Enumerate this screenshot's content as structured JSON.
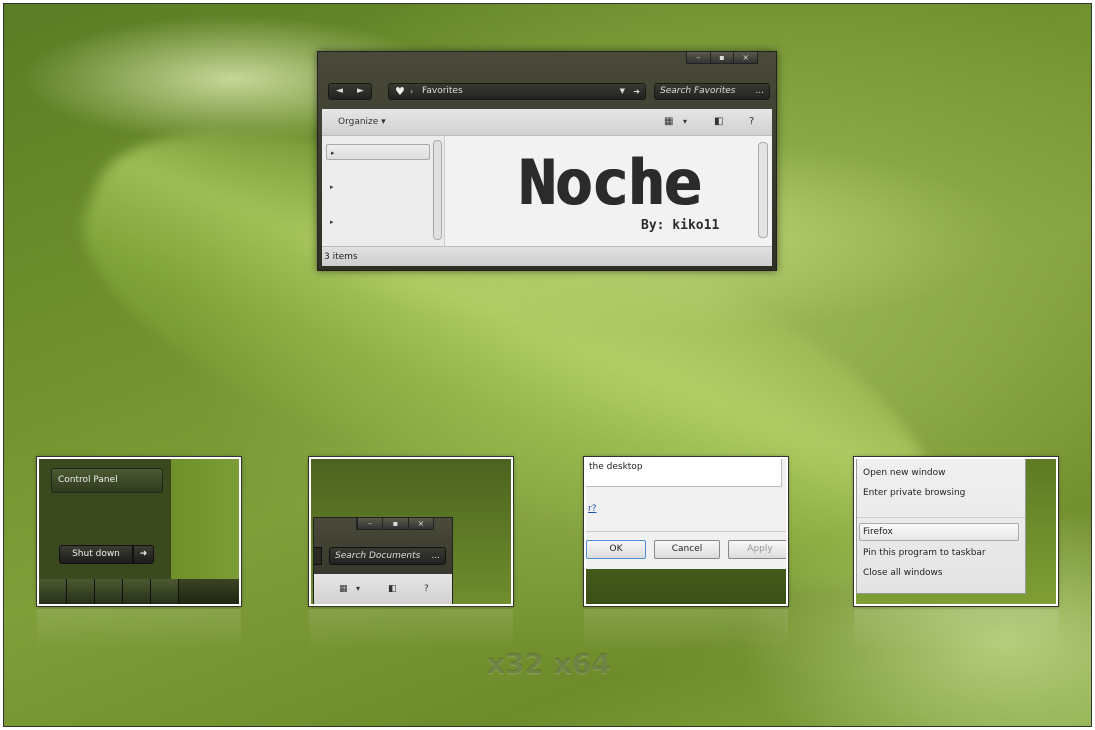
{
  "window": {
    "caption": {
      "minimize": "–",
      "maximize": "▪",
      "close": "×"
    },
    "nav": {
      "back": "◄",
      "forward": "►"
    },
    "address": {
      "icon": "heart-icon",
      "arrow": "›",
      "location": "Favorites",
      "dropdown": "▼",
      "go": "➜"
    },
    "search": {
      "placeholder": "Search Favorites",
      "more": "..."
    },
    "toolbar": {
      "organize": "Organize ▾",
      "view": "▦",
      "view_dd": "▾",
      "pane": "◧",
      "help": "?"
    },
    "nav_pane": {
      "items": [
        "▸",
        "▸",
        "▸"
      ]
    },
    "content": {
      "title": "Noche",
      "byline": "By: kiko11"
    },
    "status": {
      "text": "3 items"
    }
  },
  "thumbs": {
    "start_menu": {
      "control_panel": "Control Panel",
      "shut_down": "Shut down",
      "shut_down_arrow": "➜"
    },
    "explorer": {
      "caption": {
        "minimize": "–",
        "maximize": "▪",
        "close": "×"
      },
      "search": "Search Documents",
      "more": "...",
      "view": "▦",
      "view_dd": "▾",
      "pane": "◧",
      "help": "?"
    },
    "dialog": {
      "text": "the desktop",
      "link": "r?",
      "ok": "OK",
      "cancel": "Cancel",
      "apply": "Apply"
    },
    "jumplist": {
      "items": [
        "Open new window",
        "Enter private browsing"
      ],
      "app": "Firefox",
      "pin": "Pin this program to taskbar",
      "close_all": "Close all windows"
    }
  },
  "arch_label": "x32 x64"
}
